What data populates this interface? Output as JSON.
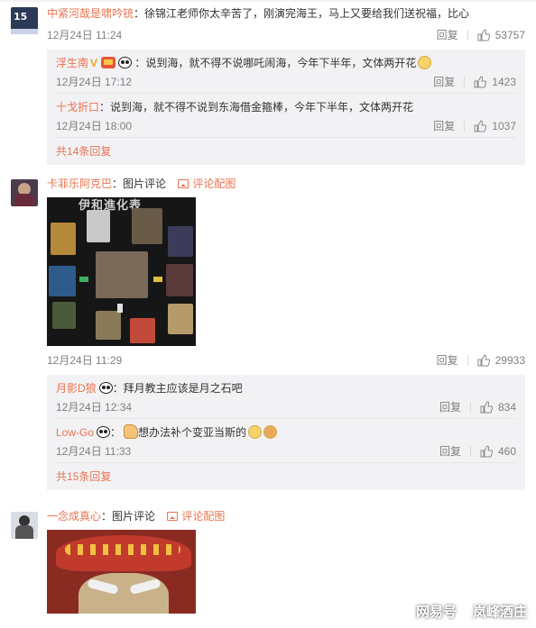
{
  "comments": [
    {
      "username": "中紧河哉是啸吟铳",
      "text": "：徐锦江老师你太辛苦了，刚演完海王，马上又要给我们送祝福，比心",
      "time": "12月24日 11:24",
      "reply_label": "回复",
      "likes": "53757",
      "replies": [
        {
          "username": "浮生南",
          "badge": "V",
          "text": "：说到海，就不得不说哪吒闹海，今年下半年，文体两开花",
          "time": "12月24日 17:12",
          "reply_label": "回复",
          "likes": "1423"
        },
        {
          "username": "十戈折口",
          "text": "：说到海，就不得不说到东海借金箍棒，今年下半年，文体两开花",
          "time": "12月24日 18:00",
          "reply_label": "回复",
          "likes": "1037"
        }
      ],
      "more": "共14条回复"
    },
    {
      "username": "卡菲乐阿克巴",
      "text": "：图片评论",
      "pic_link": "评论配图",
      "image_title": "伊和進化表",
      "time": "12月24日 11:29",
      "reply_label": "回复",
      "likes": "29933",
      "replies": [
        {
          "username": "月影D狼",
          "text": "：拜月教主应该是月之石吧",
          "time": "12月24日 12:34",
          "reply_label": "回复",
          "likes": "834"
        },
        {
          "username": "Low-Go",
          "text": "想办法补个变亚当斯的",
          "time": "12月24日 11:33",
          "reply_label": "回复",
          "likes": "460"
        }
      ],
      "more": "共15条回复"
    },
    {
      "username": "一念成真心",
      "text": "：图片评论",
      "pic_link": "评论配图"
    }
  ],
  "watermark": {
    "left": "网易号",
    "right": "岚峰酒庄"
  },
  "colors": {
    "username": "#eb7350",
    "meta": "#808080",
    "reply_bg": "#f2f2f5"
  }
}
